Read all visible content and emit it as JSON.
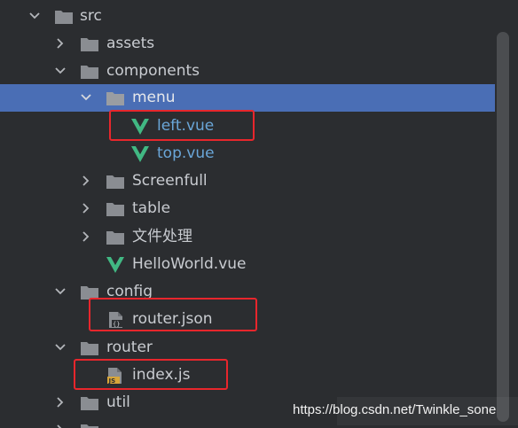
{
  "tree": {
    "items": [
      {
        "label": "src"
      },
      {
        "label": "assets"
      },
      {
        "label": "components"
      },
      {
        "label": "menu"
      },
      {
        "label": "left.vue"
      },
      {
        "label": "top.vue"
      },
      {
        "label": "Screenfull"
      },
      {
        "label": "table"
      },
      {
        "label": "文件处理"
      },
      {
        "label": "HelloWorld.vue"
      },
      {
        "label": "config"
      },
      {
        "label": "router.json"
      },
      {
        "label": "router"
      },
      {
        "label": "index.js"
      },
      {
        "label": "util"
      }
    ],
    "icons": {
      "folder": "folder-icon",
      "vue": "vue-file-icon",
      "json": "json-file-icon",
      "js": "js-file-icon"
    }
  },
  "watermark": {
    "text": "https://blog.csdn.net/Twinkle_sone"
  },
  "colors": {
    "background": "#2b2d30",
    "selection": "#4a6eb5",
    "folder": "#8a8d92",
    "vue": "#41b883",
    "highlight": "#e8262c",
    "vue_label": "#6aa6d8"
  }
}
